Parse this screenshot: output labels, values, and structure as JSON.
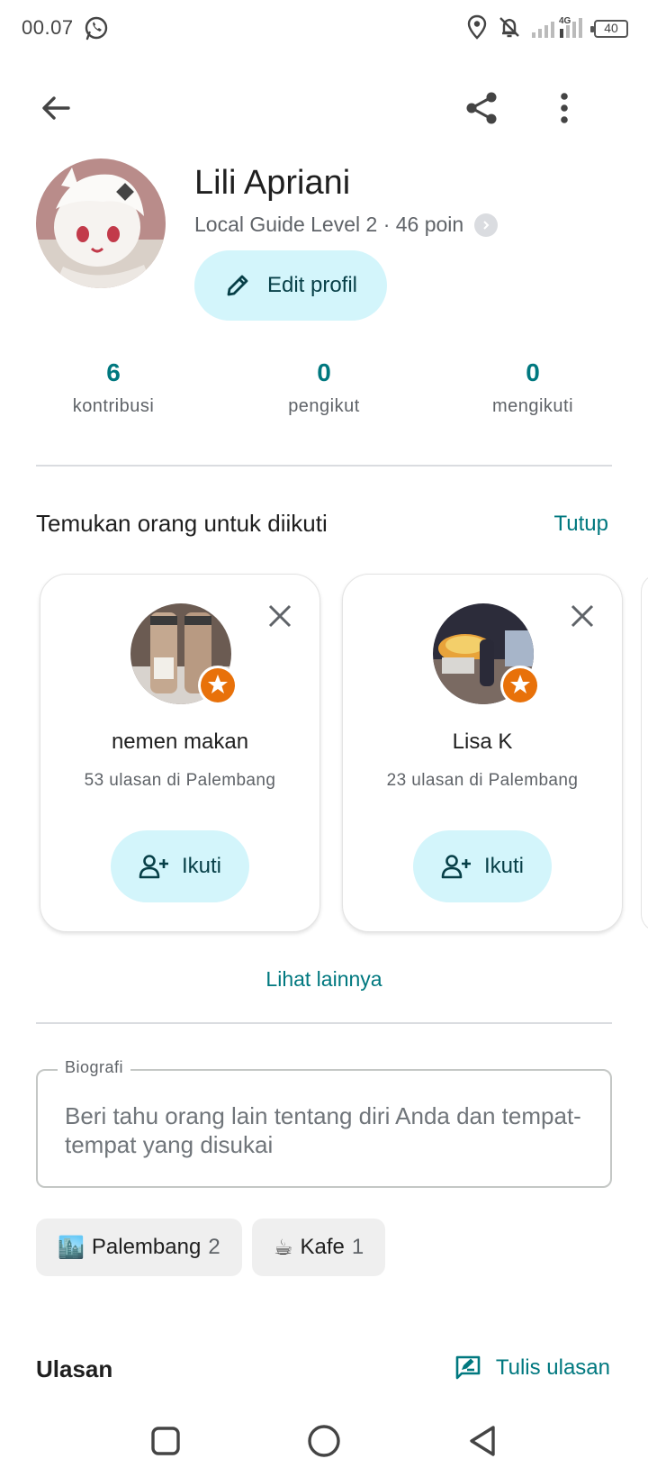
{
  "status_bar": {
    "time": "00.07",
    "network": "4G",
    "battery": "40"
  },
  "profile": {
    "name": "Lili Apriani",
    "level": "Local Guide Level 2 · 46 poin",
    "edit_label": "Edit profil"
  },
  "stats": [
    {
      "value": "6",
      "label": "kontribusi"
    },
    {
      "value": "0",
      "label": "pengikut"
    },
    {
      "value": "0",
      "label": "mengikuti"
    }
  ],
  "suggestions": {
    "title": "Temukan orang untuk diikuti",
    "close_label": "Tutup",
    "people": [
      {
        "name": "nemen makan",
        "subtitle": "53 ulasan di Palembang",
        "follow_label": "Ikuti"
      },
      {
        "name": "Lisa K",
        "subtitle": "23 ulasan di Palembang",
        "follow_label": "Ikuti"
      }
    ],
    "see_more": "Lihat lainnya"
  },
  "bio": {
    "label": "Biografi",
    "placeholder": "Beri tahu orang lain tentang diri Anda dan tempat-tempat yang disukai"
  },
  "chips": [
    {
      "emoji": "🏙️",
      "label": "Palembang",
      "count": "2"
    },
    {
      "emoji": "☕",
      "label": "Kafe",
      "count": "1"
    }
  ],
  "reviews": {
    "title": "Ulasan",
    "write_label": "Tulis ulasan"
  },
  "colors": {
    "accent": "#00787f",
    "button_bg": "#d3f5fb",
    "badge": "#e8710a"
  }
}
